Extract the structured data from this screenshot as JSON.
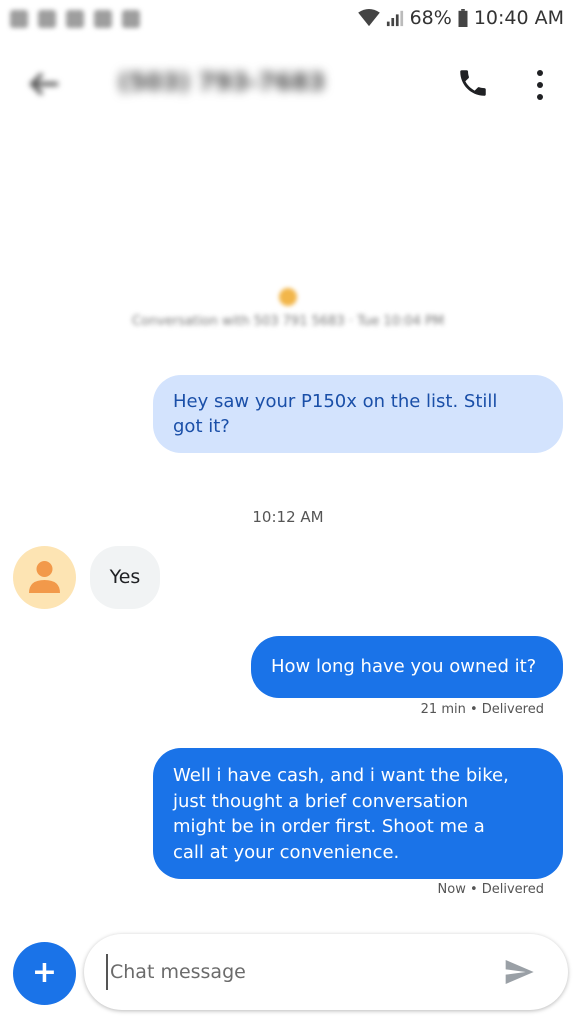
{
  "status_bar": {
    "battery_percent": "68%",
    "time": "10:40 AM",
    "icons": [
      "wifi-icon",
      "signal-icon",
      "battery-icon"
    ]
  },
  "app_bar": {
    "contact_name": "(503) 793-7683",
    "icons": [
      "back-arrow-icon",
      "phone-icon",
      "more-vert-icon"
    ]
  },
  "conversation": {
    "start_info": "Conversation with 503 791 5683 · Tue 10:04 PM",
    "messages": [
      {
        "direction": "outgoing",
        "text": "Hey saw your P150x on the list. Still got it?",
        "lines": [
          "Hey saw your P150x on the list. Still",
          "got it?"
        ]
      },
      {
        "divider": "10:12 AM"
      },
      {
        "direction": "incoming",
        "text": "Yes"
      },
      {
        "direction": "outgoing",
        "text": "How long have you owned it?",
        "meta": "21 min • Delivered"
      },
      {
        "direction": "outgoing",
        "text": "Well i have cash, and i want the bike, just thought a brief conversation might be  in order first. Shoot me a call at your convenience.",
        "lines": [
          "Well i have cash, and i want the bike,",
          "just thought a brief conversation",
          "might be  in order first. Shoot me a",
          "call at your convenience."
        ],
        "meta": "Now • Delivered"
      }
    ]
  },
  "compose": {
    "add_label": "+",
    "placeholder": "Chat message",
    "value": ""
  },
  "colors": {
    "accent": "#1a73e8",
    "outgoing_light": "#d3e3fd",
    "incoming": "#f1f3f4",
    "avatar_bg": "#fde4b3",
    "avatar_fg": "#f2994a"
  }
}
